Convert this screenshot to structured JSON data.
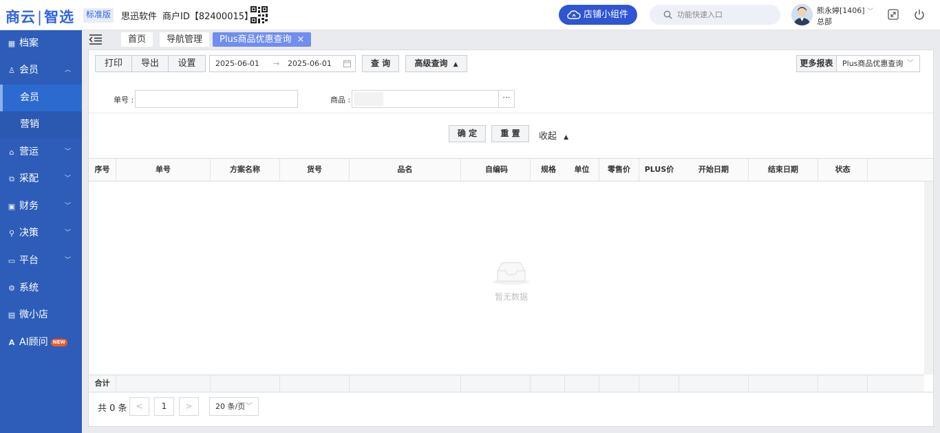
{
  "header": {
    "logo_left": "商云",
    "logo_sep": "|",
    "logo_right": "智选",
    "edition": "标准版",
    "company": "思迅软件",
    "merchant": "商户ID【82400015】",
    "widget_button": "店铺小组件",
    "search_placeholder": "功能快速入口",
    "user_name": "熊永婷[1406]",
    "user_dept": "总部",
    "brand_color": "#2f55d4"
  },
  "sidebar": {
    "items": [
      {
        "label": "档案",
        "icon": "archive-icon"
      },
      {
        "label": "会员",
        "icon": "member-icon",
        "expanded": true
      },
      {
        "label": "营运",
        "icon": "operation-icon"
      },
      {
        "label": "采配",
        "icon": "purchase-icon"
      },
      {
        "label": "财务",
        "icon": "finance-icon"
      },
      {
        "label": "决策",
        "icon": "decision-icon"
      },
      {
        "label": "平台",
        "icon": "platform-icon"
      },
      {
        "label": "系统",
        "icon": "system-icon"
      },
      {
        "label": "微小店",
        "icon": "shop-icon"
      },
      {
        "label": "AI顾问",
        "icon": "ai-icon",
        "badge": "NEW"
      }
    ],
    "sub_items": [
      {
        "label": "会员",
        "active": true
      },
      {
        "label": "营销",
        "active": false
      }
    ],
    "color": "#2d5db8"
  },
  "tabs": [
    {
      "label": "首页",
      "active": false
    },
    {
      "label": "导航管理",
      "active": false
    },
    {
      "label": "Plus商品优惠查询",
      "active": true,
      "close": "×"
    }
  ],
  "toolbar": {
    "print": "打印",
    "export": "导出",
    "settings": "设置",
    "date_start": "2025-06-01",
    "date_arrow": "→",
    "date_end": "2025-06-01",
    "query": "查 询",
    "advanced": "高级查询",
    "advanced_arrow": "▲",
    "more_reports": "更多报表",
    "report_select": "Plus商品优惠查询"
  },
  "filters": {
    "order_label": "单号 :",
    "order_value": "",
    "goods_label": "商品 :",
    "goods_value": "",
    "goods_more": "···",
    "confirm": "确 定",
    "reset": "重 置",
    "fold": "收起",
    "fold_arrow": "▲"
  },
  "table": {
    "columns": [
      "序号",
      "单号",
      "方案名称",
      "货号",
      "品名",
      "自编码",
      "规格",
      "单位",
      "零售价",
      "PLUS价",
      "开始日期",
      "结束日期",
      "状态"
    ],
    "rows": [],
    "empty_text": "暂无数据",
    "total_label": "合计"
  },
  "pagination": {
    "count_text": "共 0 条",
    "prev": "<",
    "page": "1",
    "next": ">",
    "page_size": "20 条/页"
  }
}
